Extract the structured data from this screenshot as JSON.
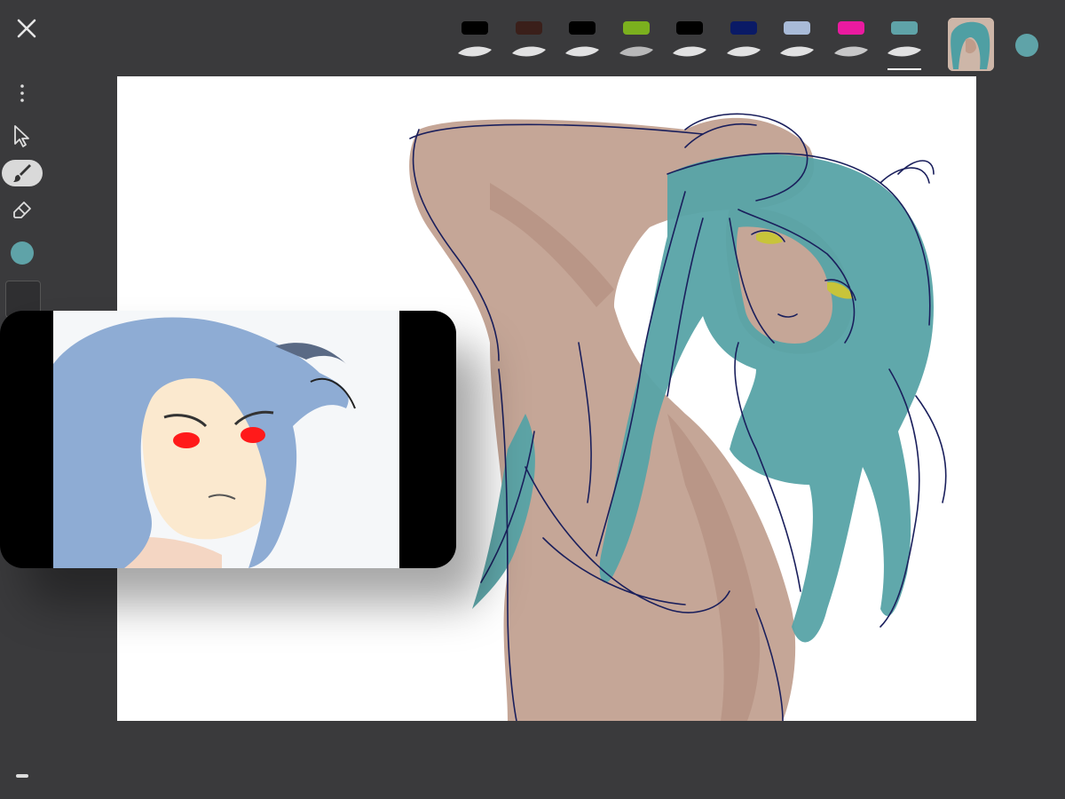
{
  "app": {
    "accent_color": "#5fa3a8"
  },
  "toolbar": {
    "close_icon": "close-icon",
    "brushes": [
      {
        "name": "brush-1",
        "swatch": "#000000",
        "stroke": "#ffffff"
      },
      {
        "name": "brush-2",
        "swatch": "#3a1f1a",
        "stroke": "#ffffff"
      },
      {
        "name": "brush-3",
        "swatch": "#000000",
        "stroke": "#ffffff"
      },
      {
        "name": "brush-4",
        "swatch": "#7bb01e",
        "stroke": "#cfcfcf"
      },
      {
        "name": "brush-5",
        "swatch": "#000000",
        "stroke": "#ffffff"
      },
      {
        "name": "brush-6",
        "swatch": "#0a1a66",
        "stroke": "#ffffff"
      },
      {
        "name": "brush-7",
        "swatch": "#a9bbd8",
        "stroke": "#ffffff"
      },
      {
        "name": "brush-8",
        "swatch": "#ea1aa0",
        "stroke": "#e0e0e0"
      },
      {
        "name": "brush-9",
        "swatch": "#5fa3a8",
        "stroke": "#ffffff",
        "selected": true
      }
    ],
    "current_color": "#5fa3a8"
  },
  "sidebar": {
    "tools": [
      "more-icon",
      "select-arrow-icon",
      "brush-icon",
      "eraser-icon"
    ],
    "active_tool": "brush-icon",
    "current_color": "#5fa3a8"
  },
  "colors": {
    "skin": "#c5a697",
    "skin_shadow": "#b39080",
    "hair": "#57a3a6",
    "line": "#1a1f5c",
    "eye": "#c8c43a",
    "ref_hair": "#8eacd4",
    "ref_skin": "#fbe9cf",
    "ref_eye": "#ff1a1a"
  }
}
